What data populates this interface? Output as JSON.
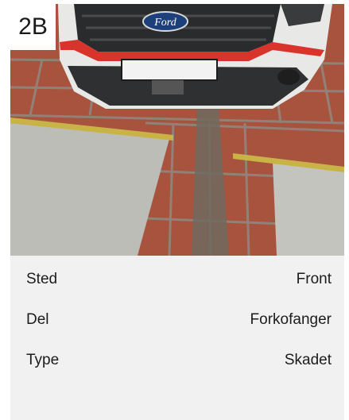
{
  "photo": {
    "badge": "2B",
    "caption_alt": "Van front bumper photo",
    "brand": "Ford"
  },
  "details": [
    {
      "label": "Sted",
      "value": "Front"
    },
    {
      "label": "Del",
      "value": "Forkofanger"
    },
    {
      "label": "Type",
      "value": "Skadet"
    }
  ],
  "colors": {
    "accent_red": "#d9342b",
    "tile": "#b6533a",
    "panel_bg": "#f1f1f1"
  }
}
